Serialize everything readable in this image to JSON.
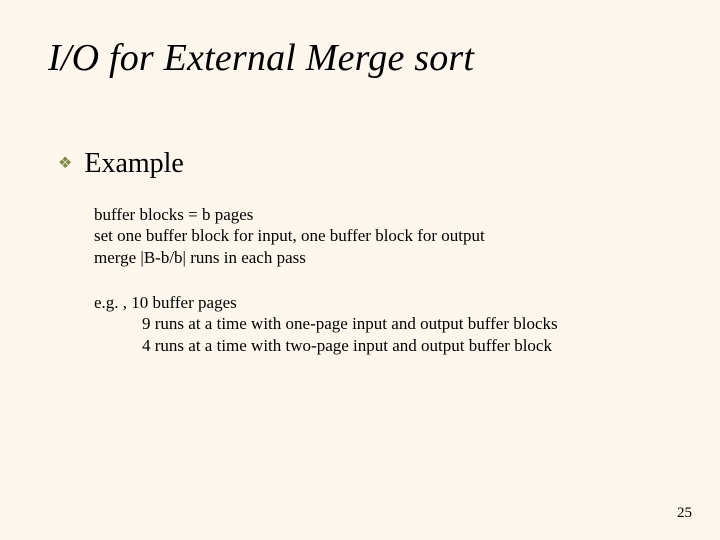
{
  "title": "I/O for External Merge sort",
  "bullet_label": "Example",
  "block1": {
    "l1": "buffer blocks = b pages",
    "l2": "set one buffer block for input, one buffer block for output",
    "l3": "merge |B-b/b| runs in each pass"
  },
  "block2": {
    "l1": "e.g. , 10 buffer pages",
    "l2": "9 runs at a time with one-page input and output buffer blocks",
    "l3": "4 runs at a time with two-page input and output buffer block"
  },
  "page_number": "25"
}
